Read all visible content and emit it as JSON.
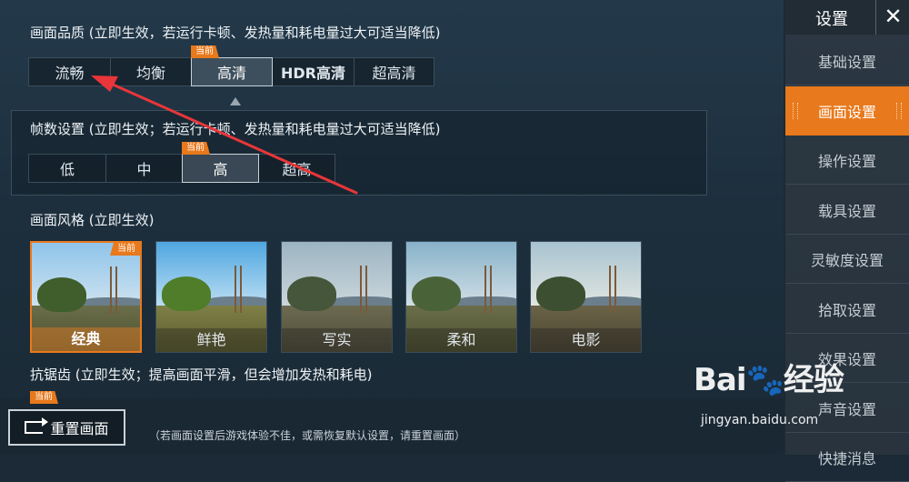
{
  "quality": {
    "title": "画面品质 (立即生效，若运行卡顿、发热量和耗电量过大可适当降低)",
    "options": [
      "流畅",
      "均衡",
      "高清",
      "HDR高清",
      "超高清"
    ],
    "current_tag": "当前"
  },
  "fps": {
    "title": "帧数设置 (立即生效；若运行卡顿、发热量和耗电量过大可适当降低)",
    "options": [
      "低",
      "中",
      "高",
      "超高"
    ],
    "current_tag": "当前"
  },
  "style": {
    "title": "画面风格 (立即生效)",
    "options": [
      "经典",
      "鲜艳",
      "写实",
      "柔和",
      "电影"
    ],
    "current_tag": "当前"
  },
  "antialias": {
    "title": "抗锯齿 (立即生效；提高画面平滑，但会增加发热和耗电)",
    "current_tag": "当前"
  },
  "bottom": {
    "reset_label": "重置画面",
    "hint": "（若画面设置后游戏体验不佳，或需恢复默认设置，请重置画面）"
  },
  "sidebar": {
    "title": "设置",
    "close": "✕",
    "items": [
      "基础设置",
      "画面设置",
      "操作设置",
      "载具设置",
      "灵敏度设置",
      "拾取设置",
      "效果设置",
      "声音设置",
      "快捷消息"
    ]
  },
  "watermark": {
    "logo": "Bai🐾经验",
    "url": "jingyan.baidu.com"
  },
  "colors": {
    "accent": "#e8791c",
    "annotation_arrow": "#e8363a"
  }
}
